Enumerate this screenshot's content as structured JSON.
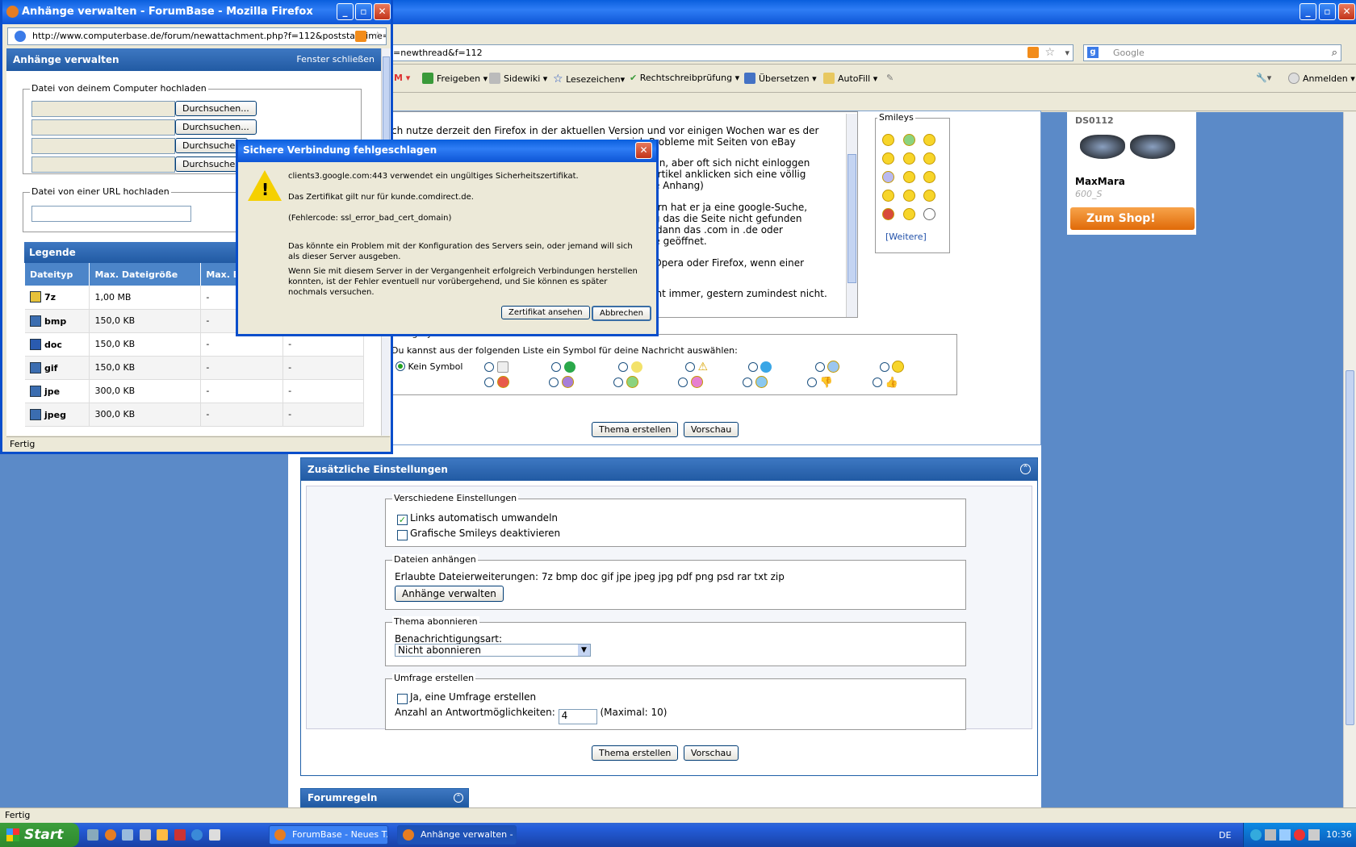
{
  "main_window": {
    "url": "=newthread&f=112",
    "search_placeholder": "Google",
    "toolbar": {
      "share": "Freigeben",
      "sidewiki": "Sidewiki",
      "bookmarks": "Lesezeichen",
      "spellcheck": "Rechtschreibprüfung",
      "translate": "Übersetzen",
      "autofill": "AutoFill",
      "signin": "Anmelden"
    },
    "status": "Fertig"
  },
  "post": {
    "lines": [
      {
        "text": "ch nutze derzeit den Firefox in der aktuellen Version und vor einigen Wochen war es der"
      },
      {
        "text": "be ich Probleme mit Seiten von eBay"
      },
      {
        "text": "kann, aber oft sich nicht einloggen"
      },
      {
        "text": "n Artikel anklicken sich eine völlig"
      },
      {
        "text": "ehe Anhang)"
      },
      {
        "text": "ntern hat er ja eine google-Suche,"
      },
      {
        "text": "folg das die Seite nicht gefunden"
      },
      {
        "text": "ch dann das .com in .de oder"
      },
      {
        "text": "eite geöffnet."
      },
      {
        "text": "E, Opera oder Firefox, wenn einer"
      },
      {
        "text": "nicht immer, gestern zumindest nicht."
      }
    ],
    "smileys_label": "Smileys",
    "more_smileys": "[Weitere]",
    "post_icons_legend": "eitragssymbole",
    "post_icons_hint": "Du kannst aus der folgenden Liste ein Symbol für deine Nachricht auswählen:",
    "no_symbol": "Kein Symbol",
    "create_thread": "Thema erstellen",
    "preview": "Vorschau"
  },
  "ad": {
    "model": "DS0112",
    "brand": "MaxMara",
    "sub": "600_S",
    "cta": "Zum Shop!"
  },
  "extra_settings": {
    "title": "Zusätzliche Einstellungen",
    "misc_legend": "Verschiedene Einstellungen",
    "auto_links": "Links automatisch umwandeln",
    "disable_smileys": "Grafische Smileys deaktivieren",
    "attach_legend": "Dateien anhängen",
    "allowed_ext": "Erlaubte Dateierweiterungen: 7z bmp doc gif jpe jpeg jpg pdf png psd rar txt zip",
    "manage_attachments": "Anhänge verwalten",
    "subscribe_legend": "Thema abonnieren",
    "notify_label": "Benachrichtigungsart:",
    "notify_value": "Nicht abonnieren",
    "poll_legend": "Umfrage erstellen",
    "poll_create": "Ja, eine Umfrage erstellen",
    "poll_count_label": "Anzahl an Antwortmöglichkeiten:",
    "poll_count_value": "4",
    "poll_max": "(Maximal: 10)",
    "create_thread": "Thema erstellen",
    "preview": "Vorschau",
    "forum_rules": "Forumregeln"
  },
  "popup": {
    "title": "Anhänge verwalten - ForumBase - Mozilla Firefox",
    "url": "http://www.computerbase.de/forum/newattachment.php?f=112&poststarttime=",
    "heading": "Anhänge verwalten",
    "close_window": "Fenster schließen",
    "upload_computer": "Datei von deinem Computer hochladen",
    "browse": "Durchsuchen...",
    "browse_clipped": "Durchsuchen",
    "upload_url": "Datei von einer URL hochladen",
    "legend_title": "Legende",
    "col_type": "Dateityp",
    "col_size": "Max. Dateigröße",
    "col_dim": "Max. B",
    "rows": [
      {
        "type": "7z",
        "size": "1,00 MB",
        "dim": "-"
      },
      {
        "type": "bmp",
        "size": "150,0 KB",
        "dim": "-"
      },
      {
        "type": "doc",
        "size": "150,0 KB",
        "dim": "-"
      },
      {
        "type": "gif",
        "size": "150,0 KB",
        "dim": "-"
      },
      {
        "type": "jpe",
        "size": "300,0 KB",
        "dim": "-"
      },
      {
        "type": "jpeg",
        "size": "300,0 KB",
        "dim": "-"
      }
    ],
    "extra_col": "-",
    "status": "Fertig"
  },
  "dialog": {
    "title": "Sichere Verbindung fehlgeschlagen",
    "line1": "clients3.google.com:443 verwendet ein ungültiges Sicherheitszertifikat.",
    "line2": "Das Zertifikat gilt nur für kunde.comdirect.de.",
    "line3": "(Fehlercode: ssl_error_bad_cert_domain)",
    "line4": "Das könnte ein Problem mit der Konfiguration des Servers sein, oder jemand will sich als dieser Server ausgeben.",
    "line5": "Wenn Sie mit diesem Server in der Vergangenheit erfolgreich Verbindungen herstellen konnten, ist der Fehler eventuell nur vorübergehend, und Sie können es später nochmals versuchen.",
    "view_cert": "Zertifikat ansehen",
    "cancel": "Abbrechen"
  },
  "taskbar": {
    "start": "Start",
    "task1": "ForumBase - Neues T...",
    "task2": "Anhänge verwalten - ...",
    "lang": "DE",
    "clock": "10:36"
  },
  "colors": {
    "xp_blue": "#0a5fdd",
    "forum_blue": "#215aa3",
    "page_bg": "#5b8ac8"
  }
}
